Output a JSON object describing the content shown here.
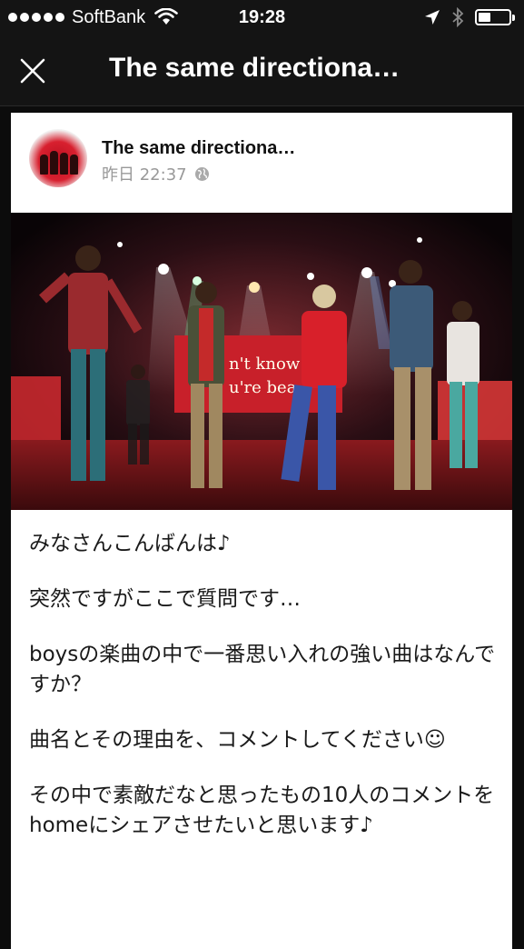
{
  "status_bar": {
    "carrier": "SoftBank",
    "time": "19:28",
    "battery_level": 0.4
  },
  "nav": {
    "title": "The same directiona…",
    "close_icon": "close-icon"
  },
  "post": {
    "page_name": "The same directiona…",
    "timestamp": "昨日 22:37",
    "privacy_icon": "globe-icon",
    "photo": {
      "screen_text_1": "n't know",
      "screen_text_2": "u're bea"
    },
    "paragraphs": [
      "みなさんこんばんは♪",
      "突然ですがここで質問です…",
      "boysの楽曲の中で一番思い入れの強い曲はなんですか？",
      "曲名とその理由を、コメントしてください☺",
      "その中で素敵だなと思ったもの10人のコメントをhomeにシェアさせたいと思います♪"
    ]
  },
  "colors": {
    "background": "#0c0c0c",
    "bar": "#141414",
    "card": "#ffffff",
    "meta": "#999999",
    "stage_red": "#c8202a"
  }
}
